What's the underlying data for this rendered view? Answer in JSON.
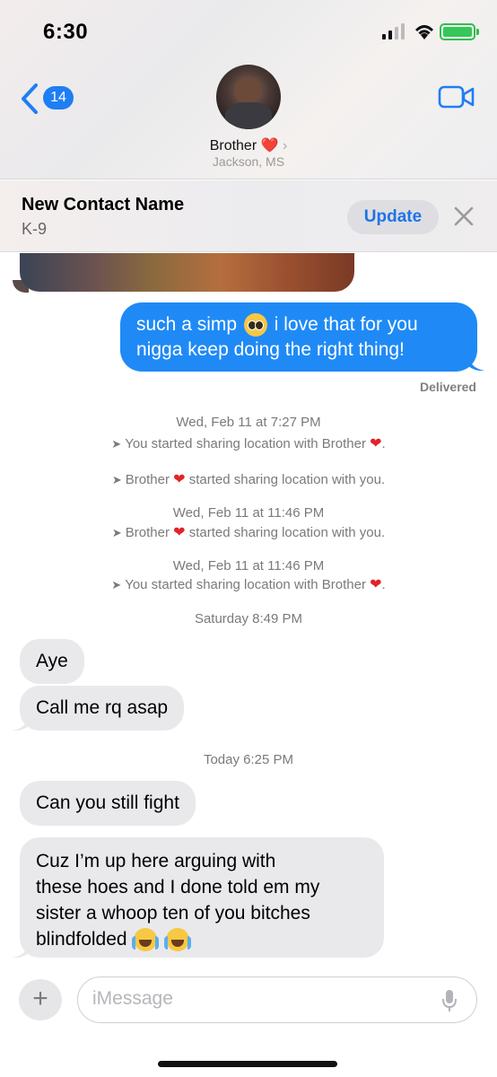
{
  "status_bar": {
    "time": "6:30"
  },
  "header": {
    "back_count": "14",
    "contact_name": "Brother",
    "contact_heart": "❤️",
    "contact_location": "Jackson, MS"
  },
  "banner": {
    "title": "New Contact Name",
    "subtitle": "K-9",
    "update_label": "Update"
  },
  "messages": {
    "outgoing_1": {
      "text_before_emoji": "such a simp",
      "text_after_emoji": "i love that for you nigga keep doing the right thing!"
    },
    "delivered": "Delivered",
    "system": [
      {
        "time": "Wed, Feb 11 at 7:27 PM",
        "line": "You started sharing location with Brother"
      },
      {
        "line_before": "Brother",
        "line_after": "started sharing location with you."
      },
      {
        "time": "Wed, Feb 11 at 11:46 PM",
        "line_before": "Brother",
        "line_after": "started sharing location with you."
      },
      {
        "time": "Wed, Feb 11 at 11:46 PM",
        "line": "You started sharing location with Brother"
      }
    ],
    "time_saturday": "Saturday 8:49 PM",
    "incoming_1": "Aye",
    "incoming_2": "Call me rq asap",
    "time_today": "Today 6:25 PM",
    "incoming_3": "Can you still fight",
    "incoming_4_lines": [
      "Cuz I’m up here arguing with",
      "these hoes and I done told em my",
      "sister a whoop ten of you bitches",
      "blindfolded"
    ]
  },
  "compose": {
    "placeholder": "iMessage"
  },
  "colors": {
    "accent_blue": "#1f8af6",
    "incoming_bubble": "#e9e9eb",
    "heart_red": "#e0242a",
    "battery_green": "#35c759"
  },
  "icons": {
    "back": "chevron-left-icon",
    "video": "video-camera-icon",
    "close": "close-icon",
    "location": "location-arrow-icon",
    "plus": "plus-icon",
    "mic": "microphone-icon"
  }
}
